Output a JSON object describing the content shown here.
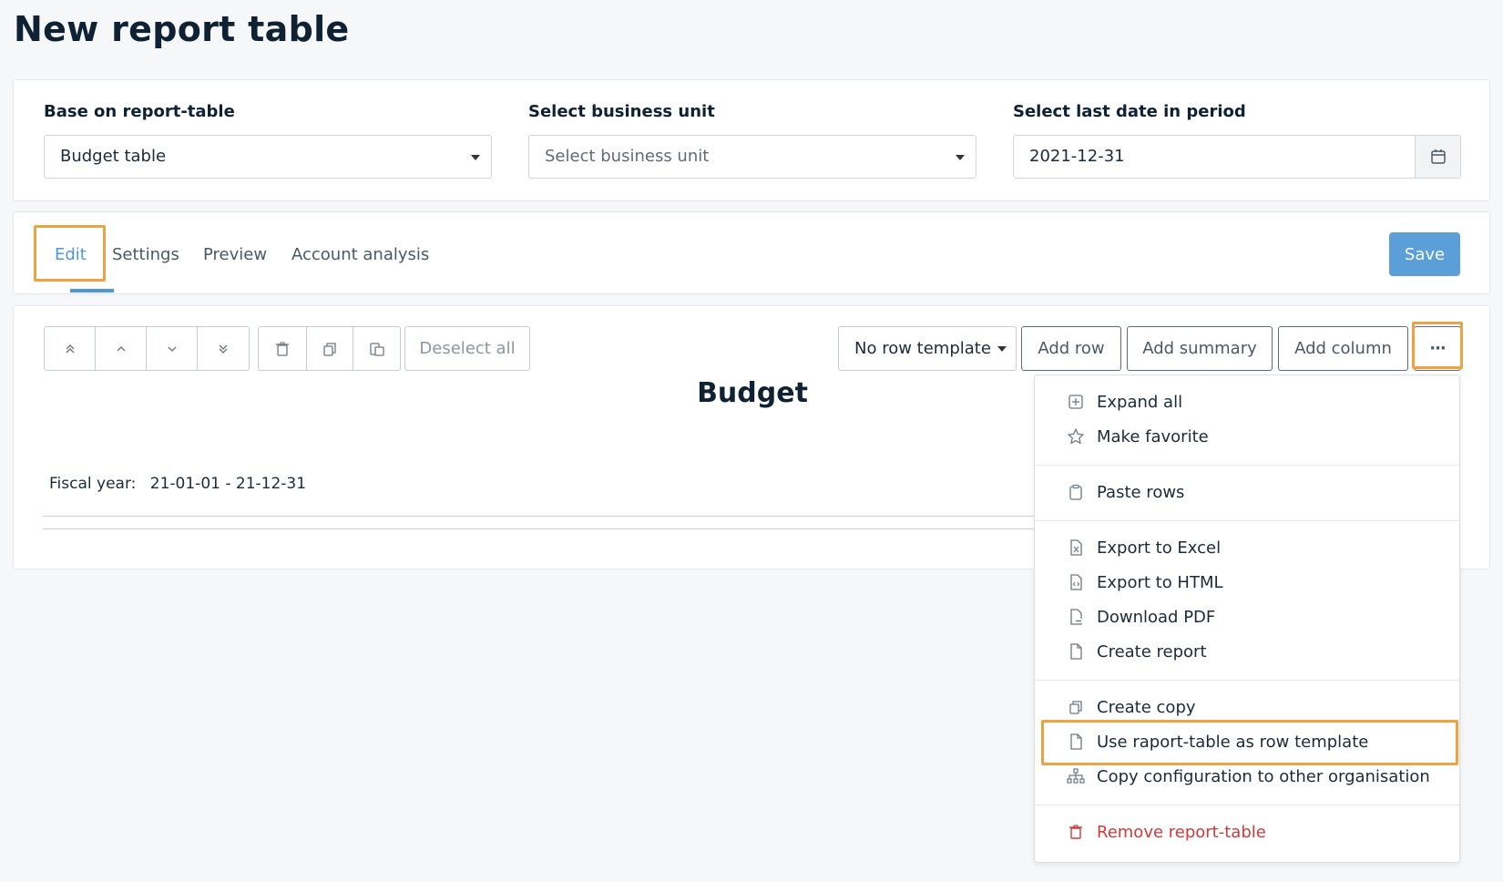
{
  "page_title": "New report table",
  "filters": {
    "base_label": "Base on report-table",
    "base_value": "Budget table",
    "unit_label": "Select business unit",
    "unit_placeholder": "Select business unit",
    "date_label": "Select last date in period",
    "date_value": "2021-12-31"
  },
  "tabs": [
    {
      "label": "Edit",
      "active": true
    },
    {
      "label": "Settings"
    },
    {
      "label": "Preview"
    },
    {
      "label": "Account analysis"
    }
  ],
  "save_label": "Save",
  "toolbar": {
    "deselect_all": "Deselect all",
    "row_template": "No row template",
    "add_row": "Add row",
    "add_summary": "Add summary",
    "add_column": "Add column",
    "more": "···"
  },
  "report": {
    "title": "Budget",
    "fiscal_label": "Fiscal year:",
    "fiscal_value": "21-01-01 - 21-12-31"
  },
  "menu": {
    "expand_all": "Expand all",
    "make_favorite": "Make favorite",
    "paste_rows": "Paste rows",
    "export_excel": "Export to Excel",
    "export_html": "Export to HTML",
    "download_pdf": "Download PDF",
    "create_report": "Create report",
    "create_copy": "Create copy",
    "use_template": "Use raport-table as row template",
    "copy_config": "Copy configuration to other organisation",
    "remove": "Remove report-table"
  },
  "colors": {
    "accent": "#4b9ad6",
    "highlight": "#f0a142",
    "danger": "#d23a3a"
  }
}
